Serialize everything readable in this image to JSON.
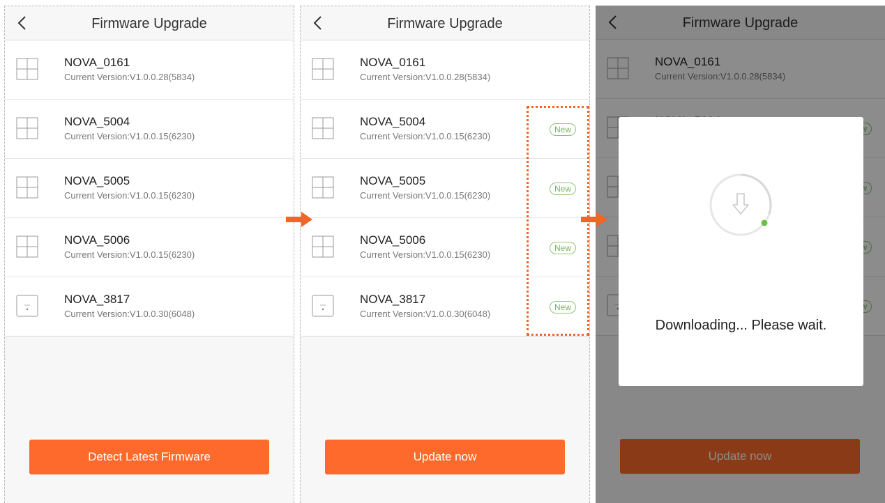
{
  "colors": {
    "accent": "#fd6a2c",
    "new_badge": "#77b35a",
    "annotation": "#f26522",
    "spinner_dot": "#6cc04a"
  },
  "header": {
    "title": "Firmware Upgrade"
  },
  "devices": [
    {
      "name": "NOVA_0161",
      "version": "Current Version:V1.0.0.28(5834)",
      "icon": "grid-device-icon"
    },
    {
      "name": "NOVA_5004",
      "version": "Current Version:V1.0.0.15(6230)",
      "icon": "grid-device-icon"
    },
    {
      "name": "NOVA_5005",
      "version": "Current Version:V1.0.0.15(6230)",
      "icon": "grid-device-icon"
    },
    {
      "name": "NOVA_5006",
      "version": "Current Version:V1.0.0.15(6230)",
      "icon": "grid-device-icon"
    },
    {
      "name": "NOVA_3817",
      "version": "Current Version:V1.0.0.30(6048)",
      "icon": "puck-device-icon"
    }
  ],
  "badge_label": "New",
  "screen1": {
    "button": "Detect Latest Firmware"
  },
  "screen2": {
    "button": "Update now"
  },
  "screen3": {
    "button": "Update now",
    "dialog_text": "Downloading... Please wait."
  }
}
